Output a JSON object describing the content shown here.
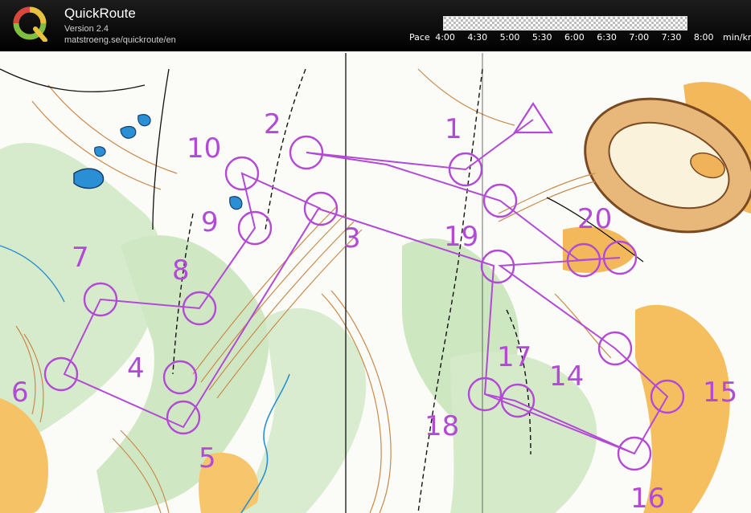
{
  "app": {
    "title": "QuickRoute",
    "version": "Version 2.4",
    "url": "matstroeng.se/quickroute/en"
  },
  "pace": {
    "label": "Pace",
    "ticks": [
      "4:00",
      "4:30",
      "5:00",
      "5:30",
      "6:00",
      "6:30",
      "7:00",
      "7:30",
      "8:00"
    ],
    "unit": "min/km"
  },
  "course": {
    "color": "#b24ad6",
    "controls": [
      "1",
      "2",
      "3",
      "4",
      "5",
      "6",
      "7",
      "8",
      "9",
      "10",
      "19",
      "20",
      "14",
      "15",
      "16",
      "17",
      "18"
    ]
  },
  "colors": {
    "header_bg": "#000000",
    "map_green": "#cfe8c3",
    "map_yellow": "#f7c56b",
    "contour": "#c98a4b",
    "water": "#2b8fd6",
    "course": "#b24ad6"
  }
}
